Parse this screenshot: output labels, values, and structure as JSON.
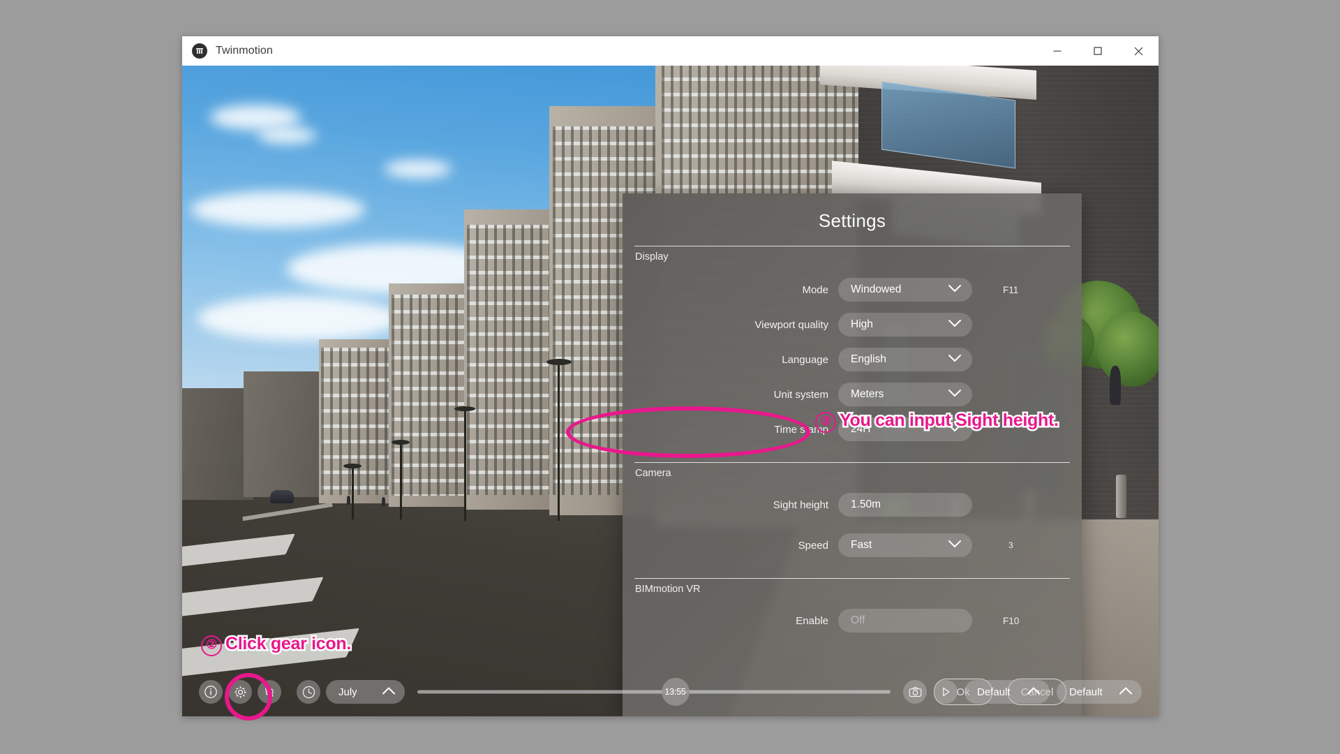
{
  "window": {
    "title": "Twinmotion",
    "logo_icon": "twinmotion-logo-icon",
    "minimize_icon": "minimize-icon",
    "maximize_icon": "maximize-icon",
    "close_icon": "close-icon"
  },
  "dialog": {
    "title": "Settings",
    "sections": [
      {
        "label": "Display",
        "rows": [
          {
            "label": "Mode",
            "value": "Windowed",
            "control": "dropdown",
            "shortcut": "F11"
          },
          {
            "label": "Viewport quality",
            "value": "High",
            "control": "dropdown",
            "shortcut": ""
          },
          {
            "label": "Language",
            "value": "English",
            "control": "dropdown",
            "shortcut": ""
          },
          {
            "label": "Unit system",
            "value": "Meters",
            "control": "dropdown",
            "shortcut": ""
          },
          {
            "label": "Time stamp",
            "value": "24H",
            "control": "dropdown",
            "shortcut": ""
          }
        ]
      },
      {
        "label": "Camera",
        "rows": [
          {
            "label": "Sight height",
            "value": "1.50m",
            "control": "input",
            "shortcut": ""
          },
          {
            "label": "Speed",
            "value": "Fast",
            "control": "dropdown",
            "shortcut": "3"
          }
        ]
      },
      {
        "label": "BIMmotion VR",
        "rows": [
          {
            "label": "Enable",
            "value": "Off",
            "control": "toggle",
            "shortcut": "F10",
            "disabled": true
          }
        ]
      }
    ],
    "buttons": {
      "ok": "Ok",
      "cancel": "Cancel"
    }
  },
  "toolbar": {
    "info_icon": "info-icon",
    "gear_icon": "gear-icon",
    "footsteps_icon": "footsteps-icon",
    "clock_icon": "clock-icon",
    "month": "July",
    "month_chevron_icon": "chevron-up-icon",
    "time": "13:55",
    "camera_icon": "camera-icon",
    "play_icon": "play-icon",
    "preset_left": "Default",
    "preset_right": "Default",
    "preset_chevron_icon": "chevron-up-icon"
  },
  "annotations": {
    "step2": {
      "number": "②",
      "text": "Click gear icon."
    },
    "step3": {
      "number": "③",
      "text": "You can input Sight height."
    }
  },
  "colors": {
    "accent_pink": "#e8188c",
    "dialog_bg": "#6a6865",
    "title_bar_bg": "#ffffff"
  }
}
